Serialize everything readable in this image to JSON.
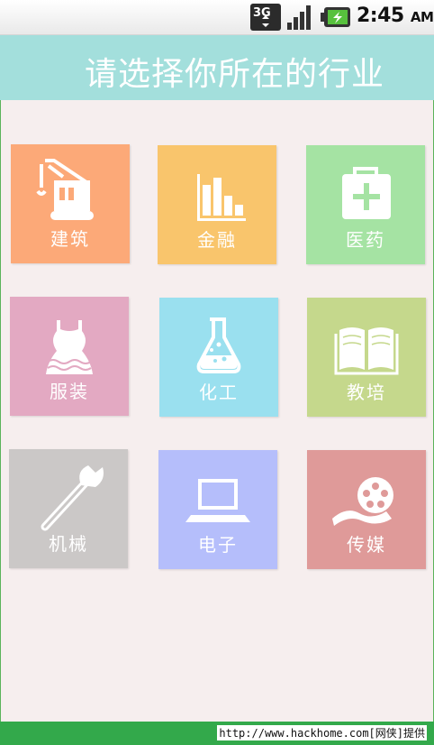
{
  "status_bar": {
    "network": "3G",
    "time": "2:45",
    "ampm": "AM"
  },
  "header": {
    "title": "请选择你所在的行业"
  },
  "industries": [
    {
      "label": "建筑",
      "icon": "crane-icon",
      "color": "#fca978"
    },
    {
      "label": "金融",
      "icon": "bar-chart-icon",
      "color": "#f9c56c"
    },
    {
      "label": "医药",
      "icon": "first-aid-kit-icon",
      "color": "#a5e3a3"
    },
    {
      "label": "服装",
      "icon": "dress-icon",
      "color": "#e3a9c2"
    },
    {
      "label": "化工",
      "icon": "flask-icon",
      "color": "#9ae0ef"
    },
    {
      "label": "教培",
      "icon": "open-book-icon",
      "color": "#c5d88c"
    },
    {
      "label": "机械",
      "icon": "wrench-icon",
      "color": "#cbc8c7"
    },
    {
      "label": "电子",
      "icon": "laptop-icon",
      "color": "#b5befb"
    },
    {
      "label": "传媒",
      "icon": "film-reel-icon",
      "color": "#df9a99"
    }
  ],
  "footer": {
    "text": "http://www.hackhome.com[网侠]提供"
  }
}
